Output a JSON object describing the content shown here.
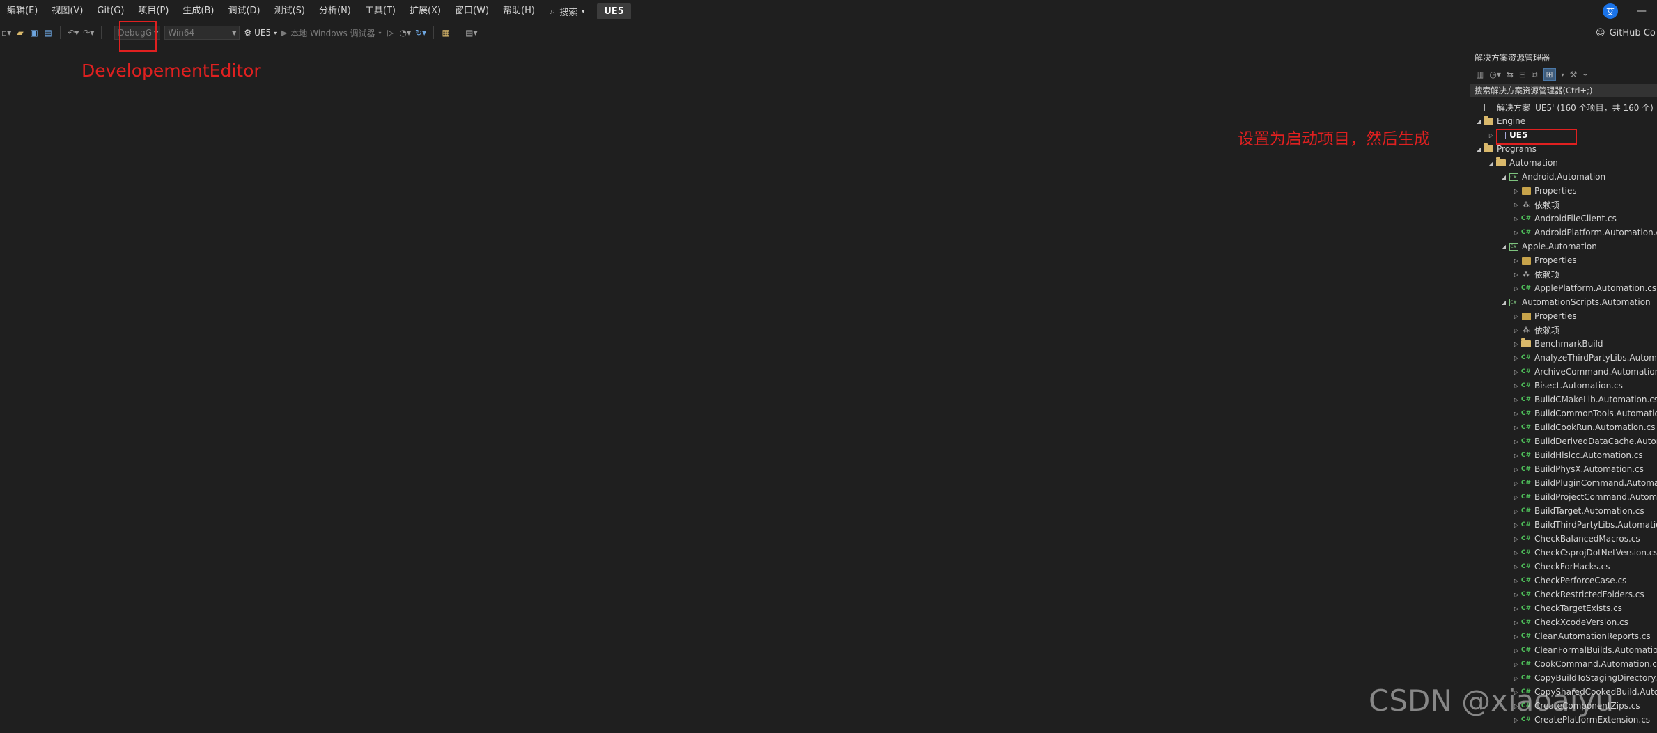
{
  "menu": {
    "items": [
      "编辑(E)",
      "视图(V)",
      "Git(G)",
      "项目(P)",
      "生成(B)",
      "调试(D)",
      "测试(S)",
      "分析(N)",
      "工具(T)",
      "扩展(X)",
      "窗口(W)",
      "帮助(H)"
    ],
    "search_label": "搜索",
    "solution_name": "UE5",
    "avatar_letter": "艾",
    "minimize_glyph": "—"
  },
  "toolbar": {
    "config_value": "DebugG",
    "platform_value": "Win64",
    "startup_project": "UE5",
    "debugger_label": "本地 Windows 调试器",
    "github_label": "GitHub Co"
  },
  "annotations": {
    "config_note": "DevelopementEditor",
    "startup_note": "设置为启动项目，然后生成"
  },
  "solution_explorer": {
    "title": "解决方案资源管理器",
    "search_placeholder": "搜索解决方案资源管理器(Ctrl+;)",
    "nodes": [
      {
        "label": "解决方案 'UE5' (160 个项目，共 160 个)",
        "level": 0,
        "expander": "none",
        "icon": "solution"
      },
      {
        "label": "Engine",
        "level": 0,
        "expander": "expanded",
        "icon": "folder"
      },
      {
        "label": "UE5",
        "level": 1,
        "expander": "collapsed",
        "icon": "cpp-project",
        "bold": true
      },
      {
        "label": "Programs",
        "level": 0,
        "expander": "expanded",
        "icon": "folder"
      },
      {
        "label": "Automation",
        "level": 1,
        "expander": "expanded",
        "icon": "folder"
      },
      {
        "label": "Android.Automation",
        "level": 2,
        "expander": "expanded",
        "icon": "cs-project"
      },
      {
        "label": "Properties",
        "level": 3,
        "expander": "collapsed",
        "icon": "properties"
      },
      {
        "label": "依赖项",
        "level": 3,
        "expander": "collapsed",
        "icon": "dependencies"
      },
      {
        "label": "AndroidFileClient.cs",
        "level": 3,
        "expander": "collapsed",
        "icon": "cs-file"
      },
      {
        "label": "AndroidPlatform.Automation.cs",
        "level": 3,
        "expander": "collapsed",
        "icon": "cs-file"
      },
      {
        "label": "Apple.Automation",
        "level": 2,
        "expander": "expanded",
        "icon": "cs-project"
      },
      {
        "label": "Properties",
        "level": 3,
        "expander": "collapsed",
        "icon": "properties"
      },
      {
        "label": "依赖项",
        "level": 3,
        "expander": "collapsed",
        "icon": "dependencies"
      },
      {
        "label": "ApplePlatform.Automation.cs",
        "level": 3,
        "expander": "collapsed",
        "icon": "cs-file"
      },
      {
        "label": "AutomationScripts.Automation",
        "level": 2,
        "expander": "expanded",
        "icon": "cs-project"
      },
      {
        "label": "Properties",
        "level": 3,
        "expander": "collapsed",
        "icon": "properties"
      },
      {
        "label": "依赖项",
        "level": 3,
        "expander": "collapsed",
        "icon": "dependencies"
      },
      {
        "label": "BenchmarkBuild",
        "level": 3,
        "expander": "collapsed",
        "icon": "folder"
      },
      {
        "label": "AnalyzeThirdPartyLibs.Automation.cs",
        "level": 3,
        "expander": "collapsed",
        "icon": "cs-file"
      },
      {
        "label": "ArchiveCommand.Automation.cs",
        "level": 3,
        "expander": "collapsed",
        "icon": "cs-file"
      },
      {
        "label": "Bisect.Automation.cs",
        "level": 3,
        "expander": "collapsed",
        "icon": "cs-file"
      },
      {
        "label": "BuildCMakeLib.Automation.cs",
        "level": 3,
        "expander": "collapsed",
        "icon": "cs-file"
      },
      {
        "label": "BuildCommonTools.Automation.cs",
        "level": 3,
        "expander": "collapsed",
        "icon": "cs-file"
      },
      {
        "label": "BuildCookRun.Automation.cs",
        "level": 3,
        "expander": "collapsed",
        "icon": "cs-file"
      },
      {
        "label": "BuildDerivedDataCache.Automation.cs",
        "level": 3,
        "expander": "collapsed",
        "icon": "cs-file"
      },
      {
        "label": "BuildHlslcc.Automation.cs",
        "level": 3,
        "expander": "collapsed",
        "icon": "cs-file"
      },
      {
        "label": "BuildPhysX.Automation.cs",
        "level": 3,
        "expander": "collapsed",
        "icon": "cs-file"
      },
      {
        "label": "BuildPluginCommand.Automation.cs",
        "level": 3,
        "expander": "collapsed",
        "icon": "cs-file"
      },
      {
        "label": "BuildProjectCommand.Automation.cs",
        "level": 3,
        "expander": "collapsed",
        "icon": "cs-file"
      },
      {
        "label": "BuildTarget.Automation.cs",
        "level": 3,
        "expander": "collapsed",
        "icon": "cs-file"
      },
      {
        "label": "BuildThirdPartyLibs.Automation.cs",
        "level": 3,
        "expander": "collapsed",
        "icon": "cs-file"
      },
      {
        "label": "CheckBalancedMacros.cs",
        "level": 3,
        "expander": "collapsed",
        "icon": "cs-file"
      },
      {
        "label": "CheckCsprojDotNetVersion.cs",
        "level": 3,
        "expander": "collapsed",
        "icon": "cs-file"
      },
      {
        "label": "CheckForHacks.cs",
        "level": 3,
        "expander": "collapsed",
        "icon": "cs-file"
      },
      {
        "label": "CheckPerforceCase.cs",
        "level": 3,
        "expander": "collapsed",
        "icon": "cs-file"
      },
      {
        "label": "CheckRestrictedFolders.cs",
        "level": 3,
        "expander": "collapsed",
        "icon": "cs-file"
      },
      {
        "label": "CheckTargetExists.cs",
        "level": 3,
        "expander": "collapsed",
        "icon": "cs-file"
      },
      {
        "label": "CheckXcodeVersion.cs",
        "level": 3,
        "expander": "collapsed",
        "icon": "cs-file"
      },
      {
        "label": "CleanAutomationReports.cs",
        "level": 3,
        "expander": "collapsed",
        "icon": "cs-file"
      },
      {
        "label": "CleanFormalBuilds.Automation.cs",
        "level": 3,
        "expander": "collapsed",
        "icon": "cs-file"
      },
      {
        "label": "CookCommand.Automation.cs",
        "level": 3,
        "expander": "collapsed",
        "icon": "cs-file"
      },
      {
        "label": "CopyBuildToStagingDirectory.cs",
        "level": 3,
        "expander": "collapsed",
        "icon": "cs-file"
      },
      {
        "label": "CopySharedCookedBuild.Automation.cs",
        "level": 3,
        "expander": "collapsed",
        "icon": "cs-file"
      },
      {
        "label": "CreateComponentZips.cs",
        "level": 3,
        "expander": "collapsed",
        "icon": "cs-file"
      },
      {
        "label": "CreatePlatformExtension.cs",
        "level": 3,
        "expander": "collapsed",
        "icon": "cs-file"
      }
    ]
  },
  "watermark": "CSDN @xiaoaiyu"
}
